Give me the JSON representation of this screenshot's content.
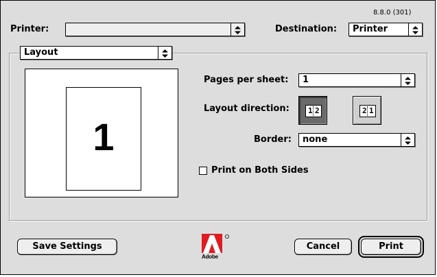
{
  "version": "8.8.0 (301)",
  "printer": {
    "label": "Printer:",
    "value": ""
  },
  "destination": {
    "label": "Destination:",
    "value": "Printer"
  },
  "panel": {
    "value": "Layout"
  },
  "preview": {
    "page_number": "1"
  },
  "pages_per_sheet": {
    "label": "Pages per sheet:",
    "value": "1"
  },
  "layout_direction": {
    "label": "Layout direction:",
    "left_to_right": {
      "a": "1",
      "b": "2",
      "selected": true
    },
    "right_to_left": {
      "a": "2",
      "b": "1",
      "selected": false
    }
  },
  "border": {
    "label": "Border:",
    "value": "none"
  },
  "print_both_sides": {
    "label": "Print on Both Sides",
    "checked": false
  },
  "logo": {
    "word": "Adobe",
    "icon": "adobe-logo-icon"
  },
  "buttons": {
    "save_settings": "Save Settings",
    "cancel": "Cancel",
    "print": "Print"
  }
}
